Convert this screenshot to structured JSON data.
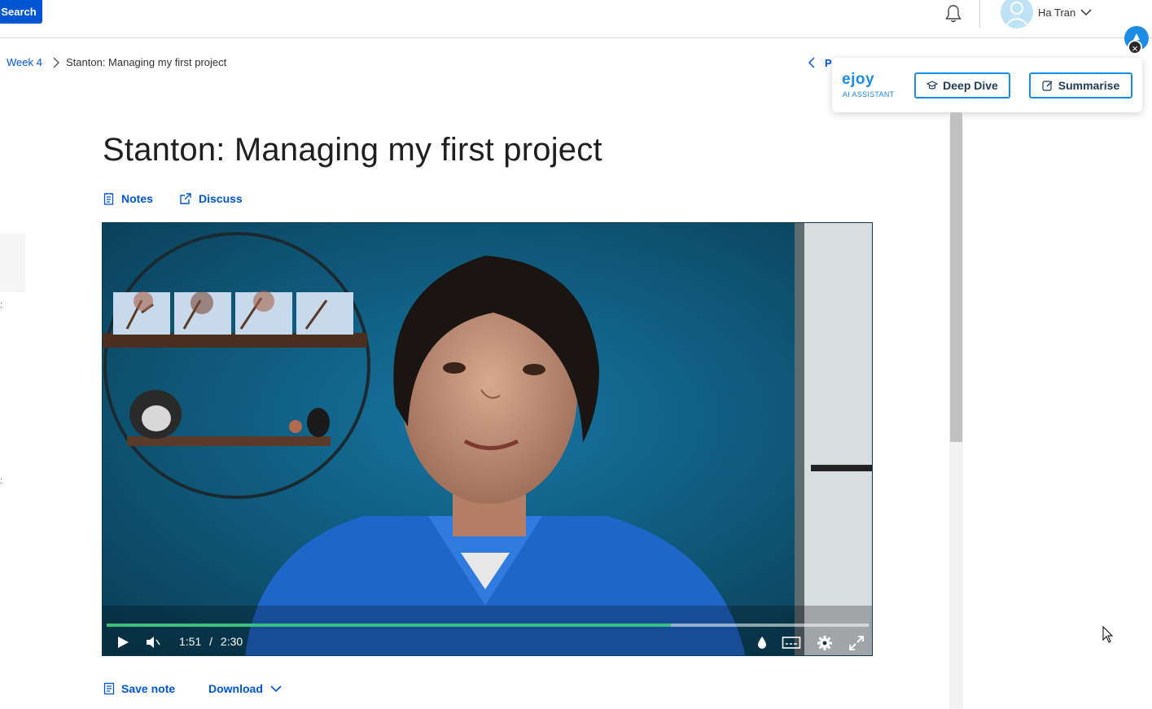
{
  "header": {
    "search_label": "Search",
    "user_name": "Ha Tran"
  },
  "breadcrumb": {
    "week": "Week 4",
    "current": "Stanton: Managing my first project",
    "prev_label": "Previous"
  },
  "ejoy": {
    "logo": "ejoy",
    "subtitle": "AI ASSISTANT",
    "deep_dive": "Deep Dive",
    "summarise": "Summarise"
  },
  "page": {
    "title": "Stanton: Managing my first project",
    "notes": "Notes",
    "discuss": "Discuss",
    "save_note": "Save note",
    "download": "Download"
  },
  "video": {
    "current_time": "1:51",
    "time_sep": "/",
    "duration": "2:30",
    "progress": 0.74
  },
  "colors": {
    "brand_blue": "#0056d2",
    "ejoy_blue": "#1c8ce4",
    "progress_green": "#3fbf7f"
  },
  "icons": [
    "bell-icon",
    "avatar-icon",
    "chevron-down-icon",
    "chevron-right-icon",
    "chevron-left-icon",
    "notes-icon",
    "external-link-icon",
    "save-note-icon",
    "play-icon",
    "volume-icon",
    "droplet-icon",
    "subtitles-icon",
    "settings-icon",
    "fullscreen-icon",
    "close-icon",
    "graduation-cap-icon",
    "edit-icon",
    "mouse-cursor-icon"
  ]
}
